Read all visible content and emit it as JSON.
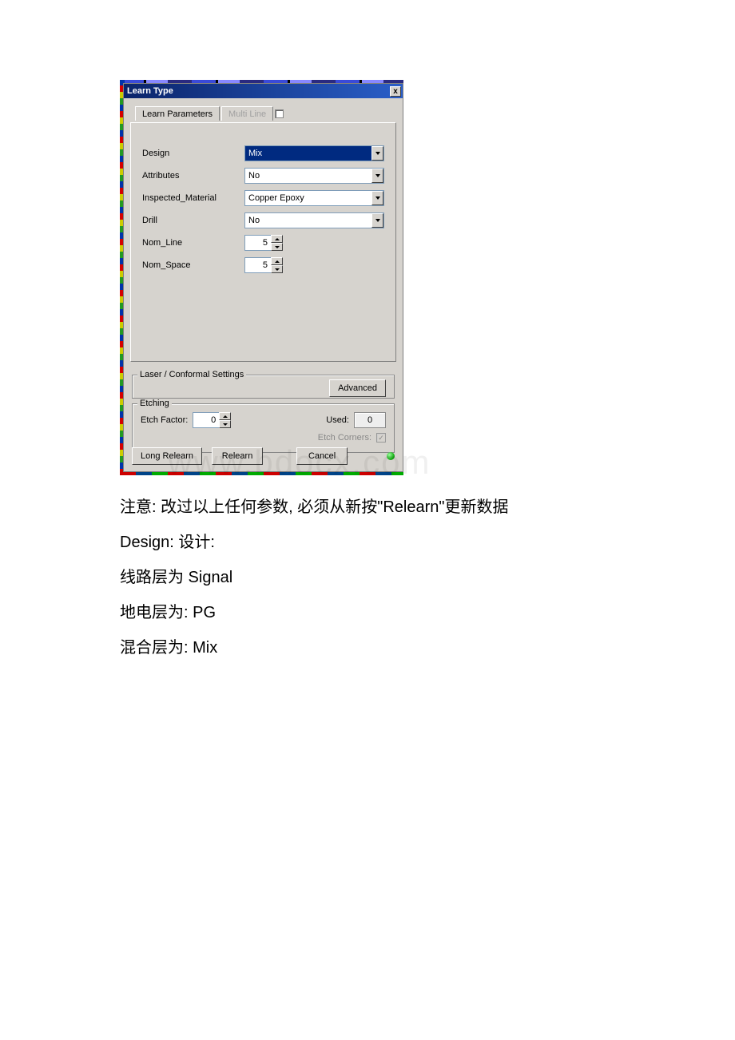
{
  "dialog": {
    "title": "Learn Type",
    "close": "x",
    "tabs": {
      "learn_parameters": "Learn Parameters",
      "multi_line": "Multi Line"
    },
    "fields": {
      "design_label": "Design",
      "design_value": "Mix",
      "attributes_label": "Attributes",
      "attributes_value": "No",
      "inspected_material_label": "Inspected_Material",
      "inspected_material_value": "Copper Epoxy",
      "drill_label": "Drill",
      "drill_value": "No",
      "nom_line_label": "Nom_Line",
      "nom_line_value": "5",
      "nom_space_label": "Nom_Space",
      "nom_space_value": "5"
    },
    "laser_legend": "Laser / Conformal Settings",
    "advanced_btn": "Advanced",
    "etch_legend": "Etching",
    "etch_factor_label": "Etch Factor:",
    "etch_factor_value": "0",
    "used_label": "Used:",
    "used_value": "0",
    "etch_corners_label": "Etch Corners:",
    "etch_corners_check": "✓",
    "buttons": {
      "long_relearn": "Long Relearn",
      "relearn": "Relearn",
      "cancel": "Cancel"
    }
  },
  "doc": {
    "note": "注意: 改过以上任何参数, 必须从新按\"Relearn\"更新数据",
    "design_line": "Design: 设计:",
    "signal_line": "线路层为 Signal",
    "pg_line": "地电层为: PG",
    "mix_line": "混合层为: Mix",
    "watermark": "www.bdocx.com"
  }
}
